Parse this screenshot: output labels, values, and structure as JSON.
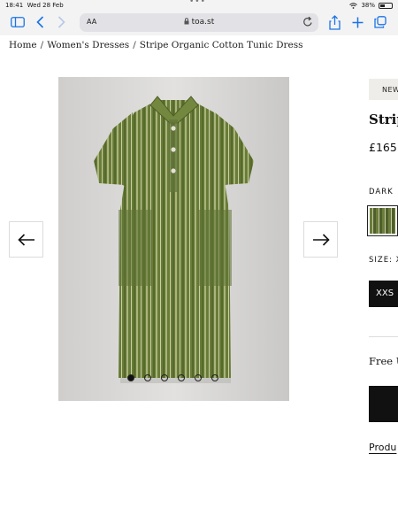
{
  "status_bar": {
    "time": "18:41",
    "date": "Wed 28 Feb",
    "battery": "38%",
    "battery_level": 0.38
  },
  "browser": {
    "text_size": "AA",
    "url": "toa.st"
  },
  "breadcrumb": [
    "Home",
    "Women's Dresses",
    "Stripe Organic Cotton Tunic Dress"
  ],
  "gallery": {
    "slide_count": 6,
    "active_slide": 1
  },
  "product": {
    "badge": "NEW",
    "title_partial": "Strip",
    "price_partial": "£165.",
    "colour_label_partial": "DARK",
    "size_label_partial": "SIZE: X",
    "selected_size": "XXS",
    "free_text_partial": "Free U",
    "details_link_partial": "Produ"
  },
  "icons": [
    "wifi-icon",
    "sidebar-icon",
    "back-icon",
    "forward-icon",
    "lock-icon",
    "reload-icon",
    "share-icon",
    "new-tab-icon",
    "tabs-icon",
    "arrow-left-icon",
    "arrow-right-icon"
  ],
  "colors": {
    "accent": "#1a73e8",
    "dress_green": "#6b7d3c",
    "photo_bg": "#d6d5d3"
  }
}
